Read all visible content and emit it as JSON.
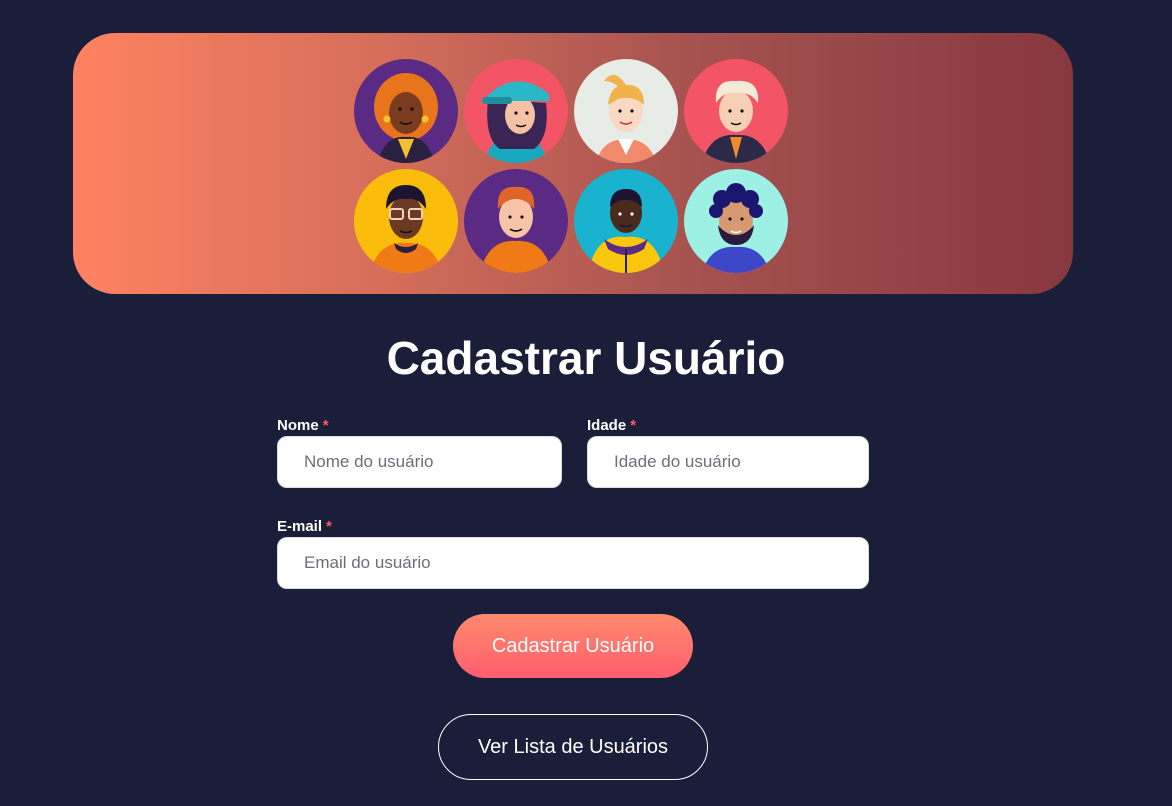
{
  "header": {
    "avatars": [
      "avatar-curly-orange-hair-icon",
      "avatar-teal-cap-icon",
      "avatar-blonde-ponytail-icon",
      "avatar-white-hair-man-icon",
      "avatar-glasses-man-icon",
      "avatar-redhead-boy-icon",
      "avatar-yellow-hoodie-icon",
      "avatar-bearded-man-icon"
    ]
  },
  "form": {
    "title": "Cadastrar Usuário",
    "required_mark": "*",
    "name": {
      "label": "Nome",
      "placeholder": "Nome do usuário"
    },
    "age": {
      "label": "Idade",
      "placeholder": "Idade do usuário"
    },
    "email": {
      "label": "E-mail",
      "placeholder": "Email do usuário"
    },
    "submit_label": "Cadastrar Usuário",
    "list_label": "Ver Lista de Usuários"
  },
  "colors": {
    "background": "#1a1e38",
    "banner_start": "#ff8262",
    "banner_end": "#87383f",
    "accent": "#ff6b6b",
    "required": "#ff5a5f"
  }
}
